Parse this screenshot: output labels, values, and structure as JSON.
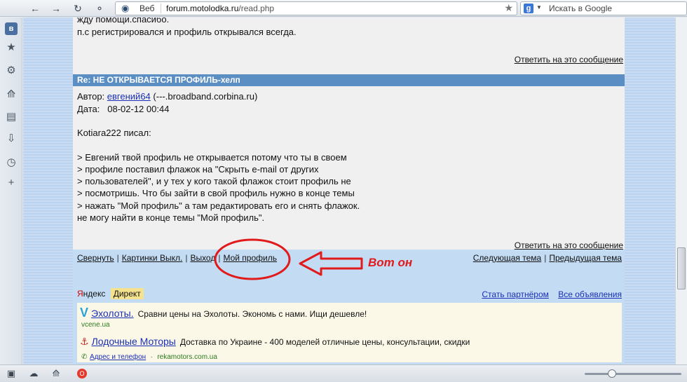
{
  "browser": {
    "address_prefix": "Веб",
    "url_host": "forum.motolodka.ru",
    "url_path": "/read.php",
    "search_placeholder": "Искать в Google",
    "search_engine_letter": "g",
    "zoom_level": 0.28
  },
  "post_top": {
    "line1": "жду помощи.спасибо.",
    "line2": "п.с регистрировался и профиль открывался всегда.",
    "reply_label": "Ответить на это сообщение"
  },
  "post": {
    "header": "Re: НЕ ОТКРЫВАЕТСЯ ПРОФИЛЬ-хелп",
    "author_label": "Автор:",
    "author_name": "евгений64",
    "author_host": "(---.broadband.corbina.ru)",
    "date_label": "Дата:",
    "date_value": "08-02-12 00:44",
    "quote_intro": "Kotiara222 писал:",
    "lines": [
      "> Евгений твой профиль не открывается потому что ты в своем",
      "> профиле поставил флажок на \"Скрыть e-mail от других",
      "> пользователей\", и у тех у кого такой флажок стоит профиль не",
      "> посмотришь. Что бы зайти в свой профиль нужно в конце темы",
      "> нажать \"Мой профиль\" а там редактировать его и снять флажок.",
      "не могу найти в конце темы \"Мой профиль\"."
    ],
    "reply_label": "Ответить на это сообщение"
  },
  "nav": {
    "collapse": "Свернуть",
    "images_off": "Картинки Выкл.",
    "logout": "Выход",
    "my_profile": "Мой профиль",
    "next_topic": "Следующая тема",
    "prev_topic": "Предыдущая тема"
  },
  "annotation": {
    "text": "Вот он",
    "color": "#e11b1b"
  },
  "ads": {
    "yandex_first": "Я",
    "yandex_rest": "ндекс",
    "direct": "Директ",
    "become_partner": "Стать партнёром",
    "all_ads": "Все объявления",
    "items": [
      {
        "title": "Эхолоты.",
        "desc": "Сравни цены на Эхолоты. Экономь с нами. Ищи дешевле!",
        "domain": "vcene.ua"
      },
      {
        "title": "Лодочные Моторы",
        "desc": "Доставка по Украине - 400 моделей отличные цены, консультации, скидки",
        "contact": "Адрес и телефон",
        "domain": "rekamotors.com.ua"
      }
    ]
  }
}
